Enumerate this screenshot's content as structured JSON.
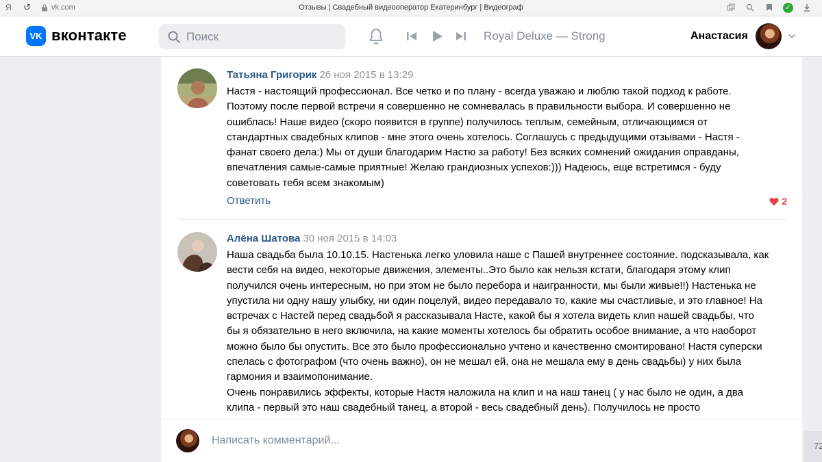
{
  "browser": {
    "logo_letter": "Я",
    "back_glyph": "↺",
    "url": "vk.com",
    "tab_title": "Отзывы | Свадебный видеооператор Екатеринбург | Видеограф"
  },
  "header": {
    "logo_letters": "VK",
    "wordmark": "вконтакте",
    "search_placeholder": "Поиск",
    "now_playing": "Royal Deluxe — Strong",
    "user_name": "Анастасия",
    "accent_color": "#0077ff"
  },
  "comments": [
    {
      "author": "Татьяна Григорик",
      "date": "26 ноя 2015 в 13:29",
      "text": "Настя - настоящий профессионал. Все четко и по плану - всегда уважаю и люблю такой подход к работе.\nПоэтому после первой встречи я совершенно не сомневалась в правильности выбора. И совершенно не\nошиблась! Наше видео (скоро появится в группе) получилось теплым, семейным, отличающимся от\nстандартных свадебных клипов - мне этого очень хотелось. Соглашусь с предыдущими отзывами - Настя -\nфанат своего дела:) Мы от души благодарим Настю за работу! Без всяких сомнений ожидания оправданы,\nвпечатления самые-самые приятные! Желаю грандиозных успехов:))) Надеюсь, еще встретимся - буду\nсоветовать тебя всем знакомым)",
      "reply_label": "Ответить",
      "likes": "2"
    },
    {
      "author": "Алёна Шатова",
      "date": "30 ноя 2015 в 14:03",
      "text": "Наша свадьба была 10.10.15. Настенька легко уловила наше с Пашей внутреннее состояние. подсказывала, как\nвести себя на видео, некоторые движения, элементы..Это было как нельзя кстати, благодаря этому клип\nполучился очень интересным, но при этом не было перебора и наигранности, мы были живые!!) Настенька не\nупустила ни одну нашу улыбку, ни один поцелуй, видео передавало то, какие мы счастливые, и это главное! На\nвстречах с Настей перед свадьбой я рассказывала Насте, какой бы я хотела видеть клип нашей свадьбы, что\nбы я обязательно в него включила, на какие моменты хотелось бы обратить особое внимание, а что наоборот\nможно было бы опустить. Все это было профессионально учтено и качественно смонтировано! Настя суперски\nспелась с фотографом (что очень важно), он не мешал ей, она не мешала ему в день свадьбы) у них была\nгармония и взаимопонимание.\nОчень понравились эффекты, которые Настя наложила на клип и на наш танец ( у нас было не один, а два\nклипа - первый это наш свадебный танец, а второй - весь свадебный день). Получилось не просто"
    }
  ],
  "composer": {
    "placeholder": "Написать комментарий..."
  },
  "side_badge": "72"
}
